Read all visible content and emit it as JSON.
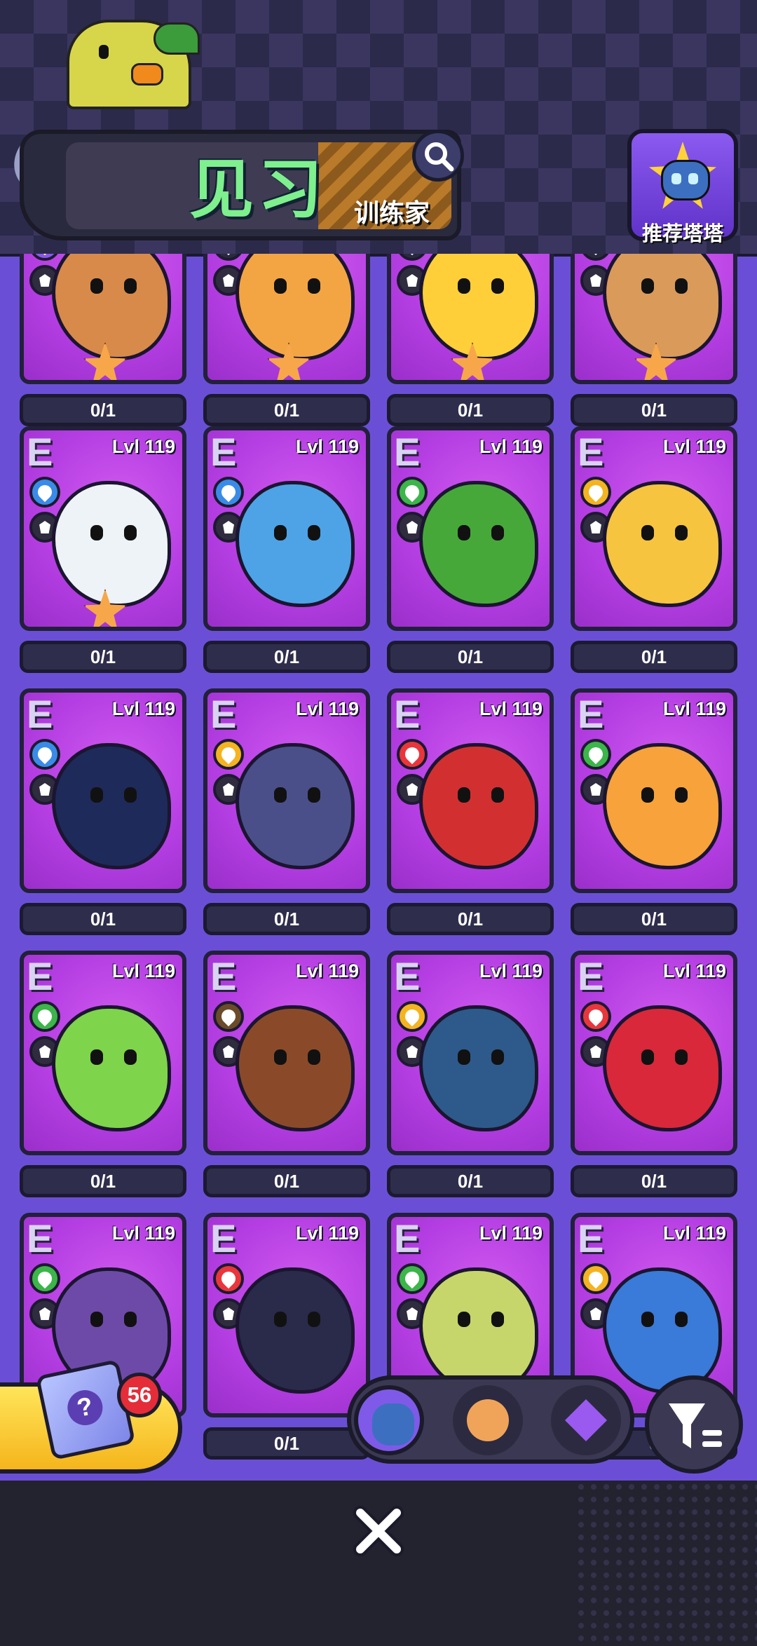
{
  "header": {
    "title": "见习",
    "subtitle": "训练家",
    "recommend_label": "推荐塔塔"
  },
  "grid": {
    "rows": [
      [
        {
          "counter": "0/1",
          "star": true,
          "elem": "#8a57e8",
          "role": "potion-icon",
          "color": "#d88a4a"
        },
        {
          "counter": "0/1",
          "star": true,
          "elem": "#2a2a3e",
          "role": "attack-icon",
          "color": "#f3a543"
        },
        {
          "counter": "0/1",
          "star": true,
          "elem": "#2a2a3e",
          "role": "shield-icon",
          "color": "#ffcf3a"
        },
        {
          "counter": "0/1",
          "star": true,
          "elem": "#2a2a3e",
          "role": "shield-icon",
          "color": "#d99a5a"
        }
      ],
      [
        {
          "rank": "E",
          "lvl": "Lvl 119",
          "counter": "0/1",
          "star": true,
          "elem": "#3a8be8",
          "role": "shield-icon",
          "color": "#eef3f8"
        },
        {
          "rank": "E",
          "lvl": "Lvl 119",
          "counter": "0/1",
          "star": false,
          "elem": "#3a8be8",
          "role": "attack-icon",
          "color": "#4da3e6"
        },
        {
          "rank": "E",
          "lvl": "Lvl 119",
          "counter": "0/1",
          "star": false,
          "elem": "#3cb54a",
          "role": "eye-icon",
          "color": "#47a83a"
        },
        {
          "rank": "E",
          "lvl": "Lvl 119",
          "counter": "0/1",
          "star": false,
          "elem": "#f4b321",
          "role": "fist-icon",
          "color": "#f6c43f"
        }
      ],
      [
        {
          "rank": "E",
          "lvl": "Lvl 119",
          "counter": "0/1",
          "star": false,
          "elem": "#3a8be8",
          "role": "shield-icon",
          "color": "#1e2a5a"
        },
        {
          "rank": "E",
          "lvl": "Lvl 119",
          "counter": "0/1",
          "star": false,
          "elem": "#f4b321",
          "role": "attack-icon",
          "color": "#4a4f8a"
        },
        {
          "rank": "E",
          "lvl": "Lvl 119",
          "counter": "0/1",
          "star": false,
          "elem": "#e8363c",
          "role": "attack-icon",
          "color": "#d23030"
        },
        {
          "rank": "E",
          "lvl": "Lvl 119",
          "counter": "0/1",
          "star": false,
          "elem": "#3cb54a",
          "role": "heal-icon",
          "color": "#f7a23a"
        }
      ],
      [
        {
          "rank": "E",
          "lvl": "Lvl 119",
          "counter": "0/1",
          "star": false,
          "elem": "#3cb54a",
          "role": "attack-icon",
          "color": "#7ed44a"
        },
        {
          "rank": "E",
          "lvl": "Lvl 119",
          "counter": "0/1",
          "star": false,
          "elem": "#6b4b2a",
          "role": "attack-icon",
          "color": "#8a4a2a"
        },
        {
          "rank": "E",
          "lvl": "Lvl 119",
          "counter": "0/1",
          "star": false,
          "elem": "#f4b321",
          "role": "attack-icon",
          "color": "#2d5a8a"
        },
        {
          "rank": "E",
          "lvl": "Lvl 119",
          "counter": "0/1",
          "star": false,
          "elem": "#e8363c",
          "role": "attack-icon",
          "color": "#d8283a"
        }
      ],
      [
        {
          "rank": "E",
          "lvl": "Lvl 119",
          "counter": "",
          "star": false,
          "elem": "#3cb54a",
          "role": "potion-icon",
          "color": "#6d4aa8"
        },
        {
          "rank": "E",
          "lvl": "Lvl 119",
          "counter": "0/1",
          "star": false,
          "elem": "#e8363c",
          "role": "attack-icon",
          "color": "#2a2a4a"
        },
        {
          "rank": "E",
          "lvl": "Lvl 119",
          "counter": "",
          "star": false,
          "elem": "#3cb54a",
          "role": "attack-icon",
          "color": "#c6d66a"
        },
        {
          "rank": "E",
          "lvl": "Lvl 119",
          "counter": "0",
          "star": false,
          "elem": "#f4b321",
          "role": "eye-icon",
          "color": "#3a7ad8"
        }
      ]
    ]
  },
  "lootbox": {
    "count": "56",
    "glyph": "?"
  },
  "tabs": [
    {
      "name": "tab-tata",
      "icon": "cat-face-icon",
      "color": "#3d6fc0"
    },
    {
      "name": "tab-pets",
      "icon": "bear-face-icon",
      "color": "#f0a45a"
    },
    {
      "name": "tab-elite",
      "icon": "crystal-cat-icon",
      "color": "#9a5af0"
    }
  ],
  "filter": {
    "icon": "filter-icon"
  },
  "close": {
    "icon": "close-icon"
  }
}
